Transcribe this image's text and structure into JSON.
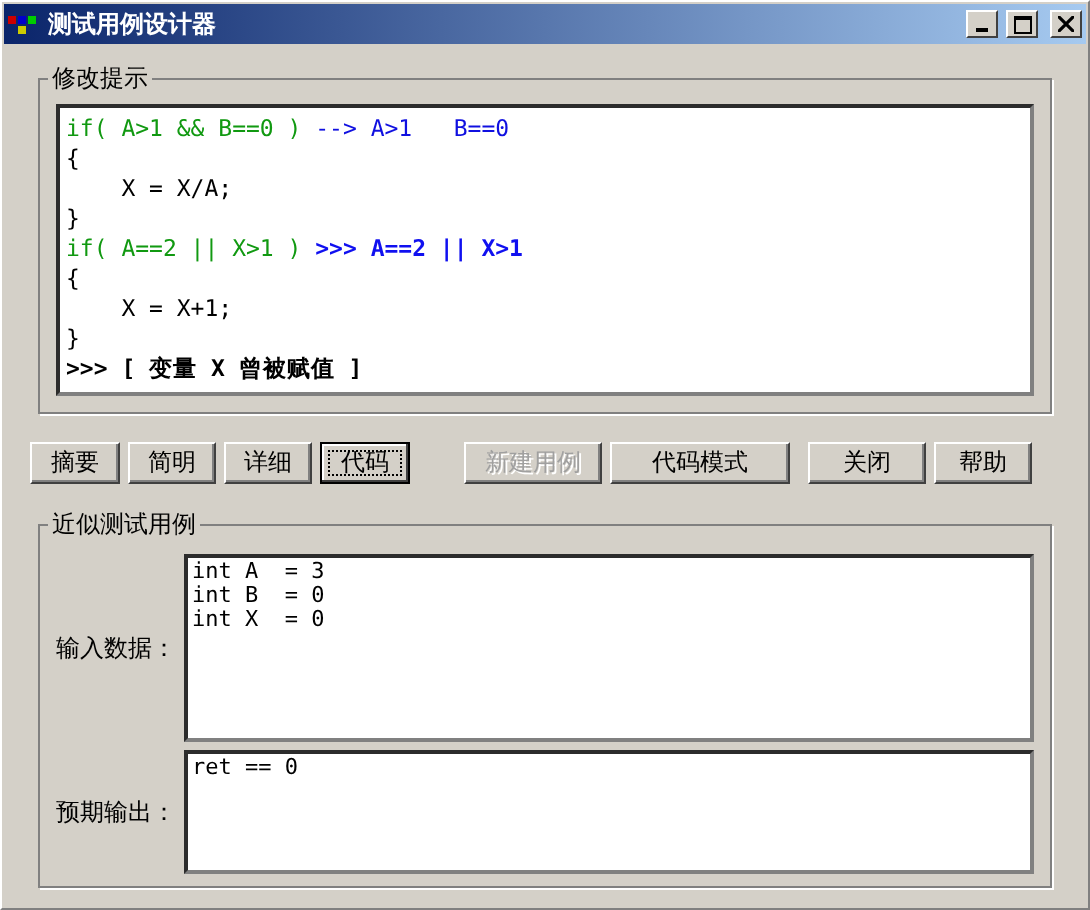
{
  "window": {
    "title": "测试用例设计器"
  },
  "hint_group": {
    "title": "修改提示",
    "lines": [
      [
        {
          "text": "if( A>1 && B==0 ) ",
          "kind": "cond"
        },
        {
          "text": "--> A>1   B==0",
          "kind": "note"
        }
      ],
      [
        {
          "text": "{",
          "kind": "plain"
        }
      ],
      [
        {
          "text": "    X = X/A;",
          "kind": "plain"
        }
      ],
      [
        {
          "text": "}",
          "kind": "plain"
        }
      ],
      [
        {
          "text": "if( A==2 || X>1 ) ",
          "kind": "cond"
        },
        {
          "text": ">>> A==2 || X>1",
          "kind": "hint"
        }
      ],
      [
        {
          "text": "{",
          "kind": "plain"
        }
      ],
      [
        {
          "text": "    X = X+1;",
          "kind": "plain"
        }
      ],
      [
        {
          "text": "}",
          "kind": "plain"
        }
      ],
      [
        {
          "text": ">>> [ 变量 X 曾被赋值 ]",
          "kind": "result"
        }
      ]
    ]
  },
  "view_buttons": [
    {
      "label": "摘要",
      "selected": false
    },
    {
      "label": "简明",
      "selected": false
    },
    {
      "label": "详细",
      "selected": false
    },
    {
      "label": "代码",
      "selected": true
    }
  ],
  "action_buttons": [
    {
      "label": "新建用例",
      "disabled": true
    },
    {
      "label": "代码模式",
      "disabled": false
    },
    {
      "label": "关闭",
      "disabled": false
    },
    {
      "label": "帮助",
      "disabled": false
    }
  ],
  "case_group": {
    "title": "近似测试用例",
    "fields": [
      {
        "label": "输入数据：",
        "value": "int A  = 3\nint B  = 0\nint X  = 0"
      },
      {
        "label": "预期输出：",
        "value": "ret == 0"
      }
    ]
  }
}
